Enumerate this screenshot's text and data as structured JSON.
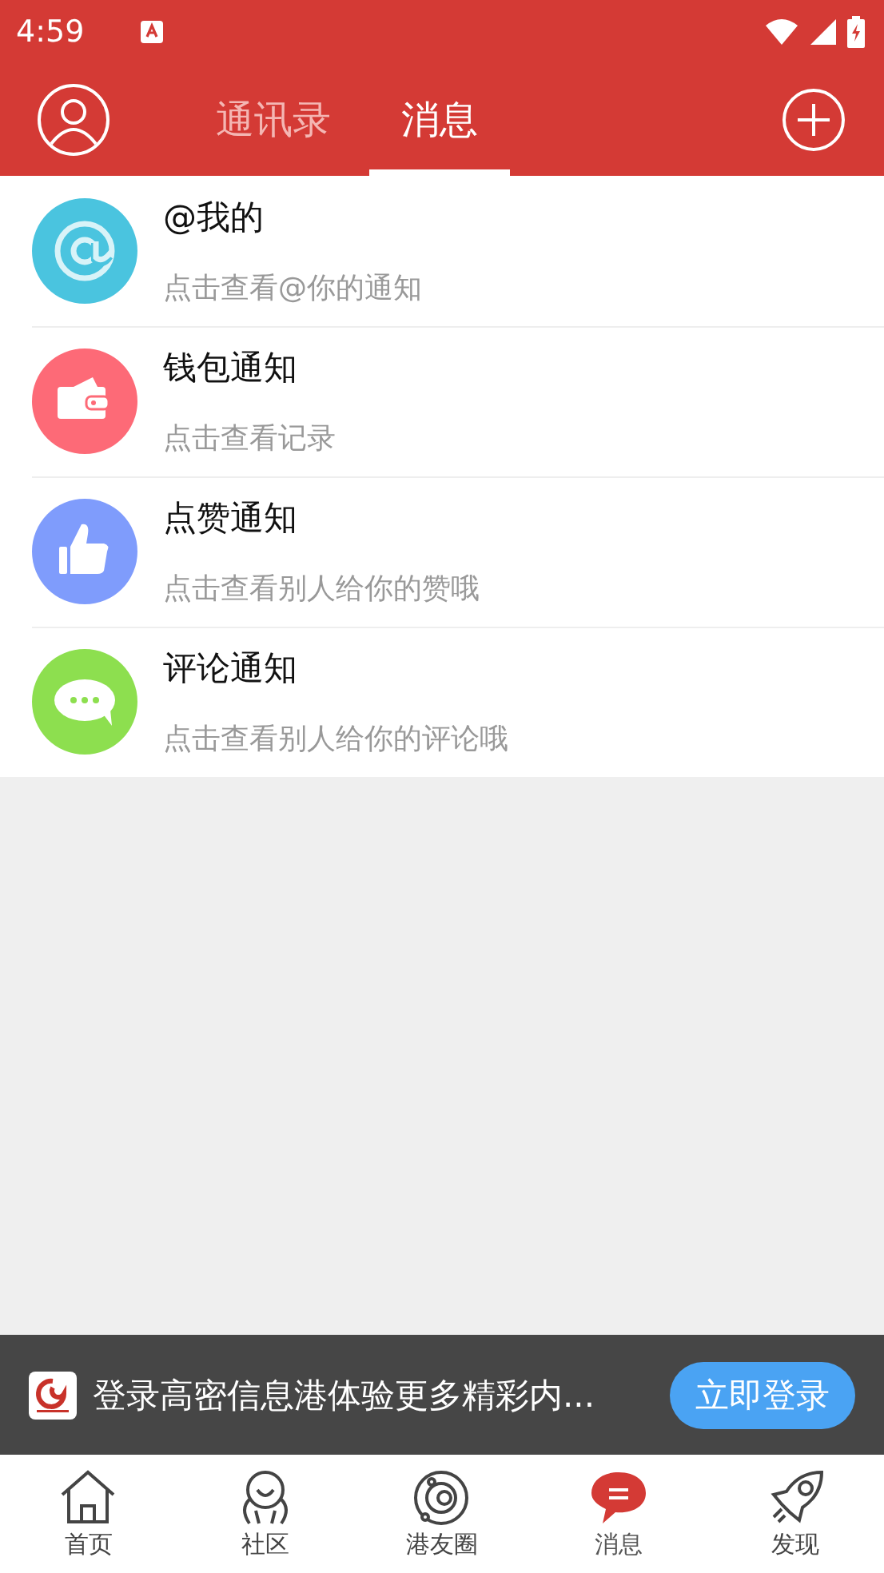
{
  "status_bar": {
    "time": "4:59"
  },
  "header": {
    "tabs": [
      {
        "label": "通讯录",
        "selected": false
      },
      {
        "label": "消息",
        "selected": true
      }
    ]
  },
  "notifications": [
    {
      "kind": "mention",
      "title": "@我的",
      "subtitle": "点击查看@你的通知",
      "color": "#4ac4df"
    },
    {
      "kind": "wallet",
      "title": "钱包通知",
      "subtitle": "点击查看记录",
      "color": "#fd6a77"
    },
    {
      "kind": "like",
      "title": "点赞通知",
      "subtitle": "点击查看别人给你的赞哦",
      "color": "#7f9cfc"
    },
    {
      "kind": "comment",
      "title": "评论通知",
      "subtitle": "点击查看别人给你的评论哦",
      "color": "#8ddf4f"
    }
  ],
  "login_banner": {
    "text": "登录高密信息港体验更多精彩内...",
    "button": "立即登录"
  },
  "bottom_nav": [
    {
      "kind": "home",
      "label": "首页",
      "selected": false
    },
    {
      "kind": "community",
      "label": "社区",
      "selected": false
    },
    {
      "kind": "circle",
      "label": "港友圈",
      "selected": false
    },
    {
      "kind": "message",
      "label": "消息",
      "selected": true
    },
    {
      "kind": "discover",
      "label": "发现",
      "selected": false
    }
  ]
}
